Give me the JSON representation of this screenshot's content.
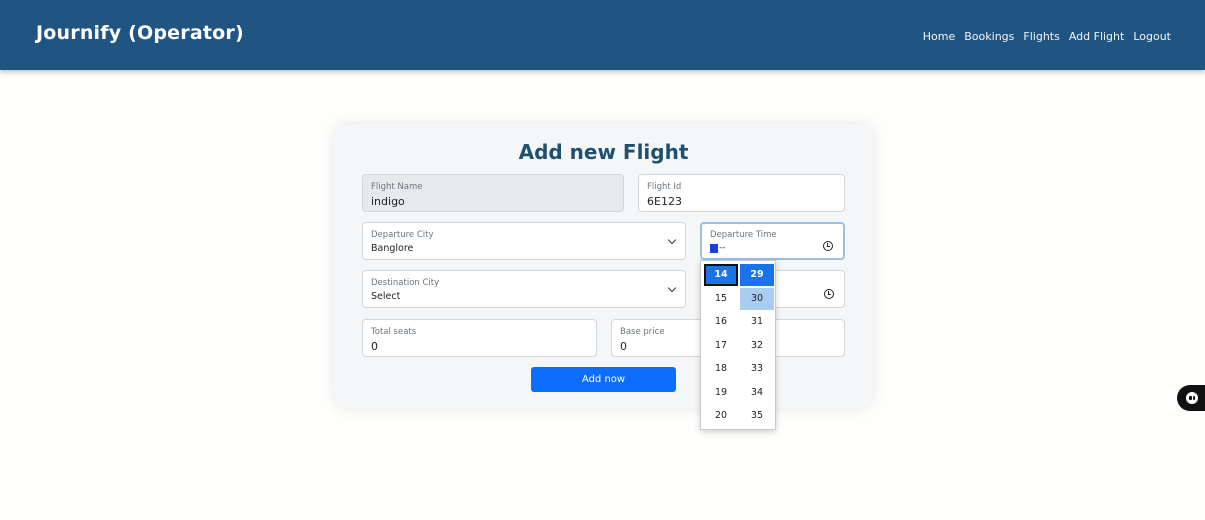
{
  "app": {
    "title": "Journify (Operator)"
  },
  "nav": {
    "items": [
      "Home",
      "Bookings",
      "Flights",
      "Add Flight",
      "Logout"
    ]
  },
  "form": {
    "title": "Add new Flight",
    "flight_name": {
      "label": "Flight Name",
      "value": "indigo"
    },
    "flight_id": {
      "label": "Flight Id",
      "value": "6E123"
    },
    "departure_city": {
      "label": "Departure City",
      "value": "Banglore"
    },
    "departure_time": {
      "label": "Departure Time",
      "value": "--"
    },
    "destination_city": {
      "label": "Destination City",
      "value": "Select"
    },
    "total_seats": {
      "label": "Total seats",
      "value": "0"
    },
    "base_price": {
      "label": "Base price",
      "value": "0"
    },
    "submit_label": "Add now"
  },
  "time_picker": {
    "hours": [
      "14",
      "15",
      "16",
      "17",
      "18",
      "19",
      "20"
    ],
    "minutes": [
      "29",
      "30",
      "31",
      "32",
      "33",
      "34",
      "35"
    ],
    "selected_hour": "14",
    "selected_minute": "29",
    "hover_minute": "30"
  },
  "colors": {
    "navbar": "#1f5580",
    "accent": "#0d6efd",
    "title": "#21506f"
  },
  "icons": {
    "chat_bot": "chat-bot-icon"
  }
}
